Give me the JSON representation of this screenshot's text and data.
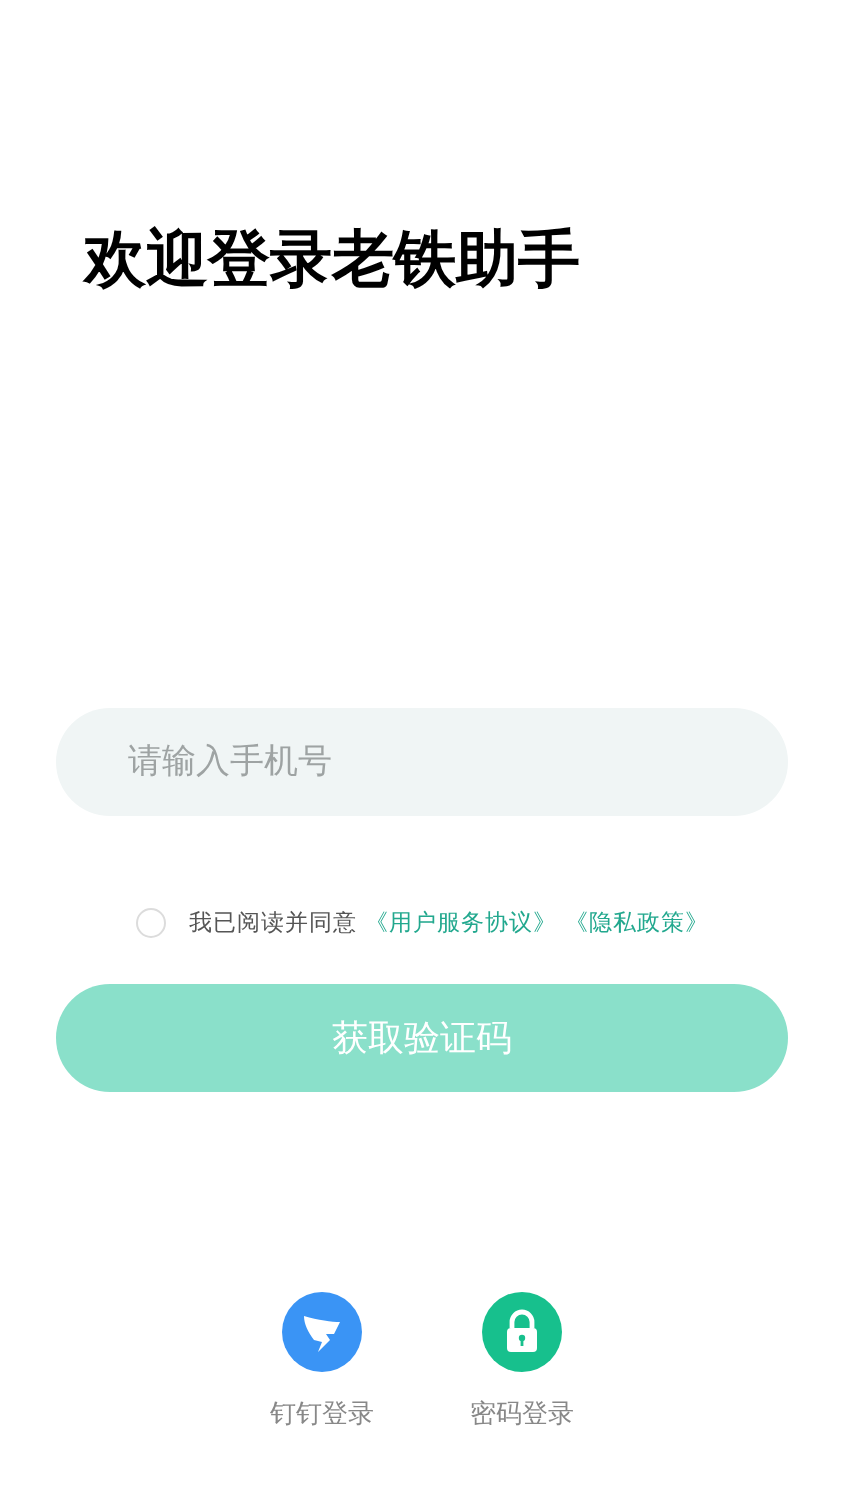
{
  "title": "欢迎登录老铁助手",
  "phone_field": {
    "placeholder": "请输入手机号"
  },
  "agreement": {
    "checked": false,
    "text": "我已阅读并同意",
    "links": [
      "《用户服务协议》",
      "《隐私政策》"
    ]
  },
  "submit_button": {
    "label": "获取验证码",
    "disabled": true
  },
  "login_options": [
    {
      "kind": "dingtalk",
      "label": "钉钉登录"
    },
    {
      "kind": "password",
      "label": "密码登录"
    }
  ]
}
